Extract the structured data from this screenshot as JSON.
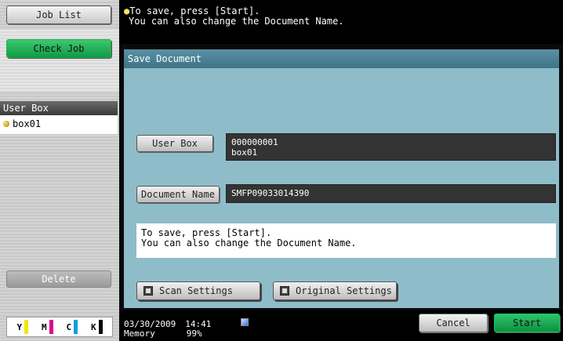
{
  "left_panel": {
    "job_list_label": "Job List",
    "check_job_label": "Check Job",
    "user_box_header": "User Box",
    "user_box_items": [
      "box01"
    ],
    "delete_label": "Delete",
    "toners": [
      {
        "letter": "Y",
        "color": "#f2e600"
      },
      {
        "letter": "M",
        "color": "#e0008a"
      },
      {
        "letter": "C",
        "color": "#00a0e0"
      },
      {
        "letter": "K",
        "color": "#000000"
      }
    ]
  },
  "top_message": {
    "line1": "To save, press [Start].",
    "line2": "You can also change the Document Name."
  },
  "dialog": {
    "title": "Save Document",
    "user_box_label": "User Box",
    "user_box_number": "000000001",
    "user_box_name": "box01",
    "document_name_label": "Document Name",
    "document_name_value": "SMFP09033014390",
    "message_line1": "To save, press [Start].",
    "message_line2": "You can also change the Document Name.",
    "scan_settings_label": "Scan Settings",
    "original_settings_label": "Original Settings"
  },
  "status_bar": {
    "date": "03/30/2009",
    "time": "14:41",
    "memory_label": "Memory",
    "memory_value": "99%"
  },
  "footer": {
    "cancel_label": "Cancel",
    "start_label": "Start"
  },
  "colors": {
    "title_bar": "#4a8296",
    "body_bg": "#8fbcc9",
    "start_green": "#1aa852"
  }
}
